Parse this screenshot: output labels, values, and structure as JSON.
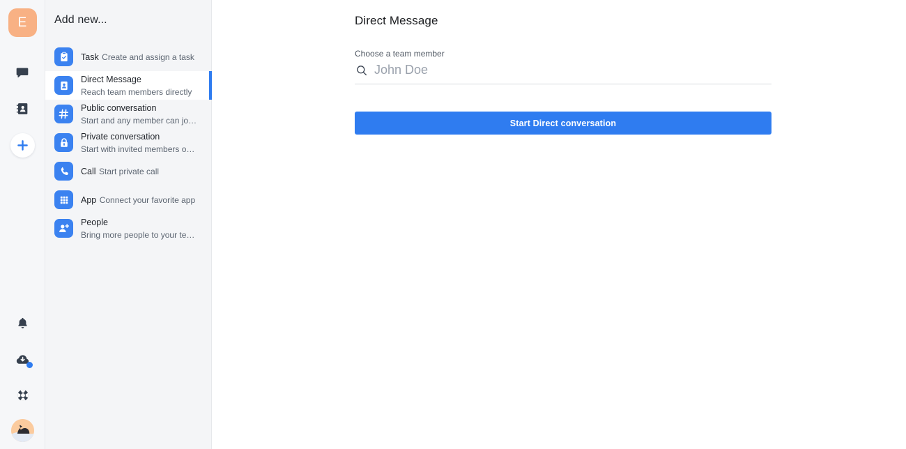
{
  "rail": {
    "team_avatar_letter": "E",
    "team_avatar_color": "#f8b184",
    "accent_color": "#2f7cf0",
    "icons": [
      {
        "name": "chat-icon",
        "label": "Chat"
      },
      {
        "name": "contacts-icon",
        "label": "Contacts"
      },
      {
        "name": "add-icon",
        "label": "Add new"
      },
      {
        "name": "bell-icon",
        "label": "Notifications"
      },
      {
        "name": "cloud-download-icon",
        "label": "Downloads"
      },
      {
        "name": "help-icon",
        "label": "Help"
      },
      {
        "name": "user-avatar",
        "label": "Account"
      }
    ]
  },
  "panel": {
    "title": "Add new...",
    "items": [
      {
        "icon": "task-icon",
        "title": "Task",
        "subtitle": "Create and assign a task",
        "active": false
      },
      {
        "icon": "direct-message-icon",
        "title": "Direct Message",
        "subtitle": "Reach team members directly",
        "active": true
      },
      {
        "icon": "hash-icon",
        "title": "Public conversation",
        "subtitle": "Start and any member can jo…",
        "active": false
      },
      {
        "icon": "lock-icon",
        "title": "Private conversation",
        "subtitle": "Start with invited members o…",
        "active": false
      },
      {
        "icon": "phone-icon",
        "title": "Call",
        "subtitle": "Start private call",
        "active": false
      },
      {
        "icon": "grid-icon",
        "title": "App",
        "subtitle": "Connect your favorite app",
        "active": false
      },
      {
        "icon": "person-add-icon",
        "title": "People",
        "subtitle": "Bring more people to your te…",
        "active": false
      }
    ]
  },
  "main": {
    "title": "Direct Message",
    "field_label": "Choose a team member",
    "search_value": "",
    "search_placeholder": "John Doe",
    "submit_label": "Start Direct conversation"
  }
}
